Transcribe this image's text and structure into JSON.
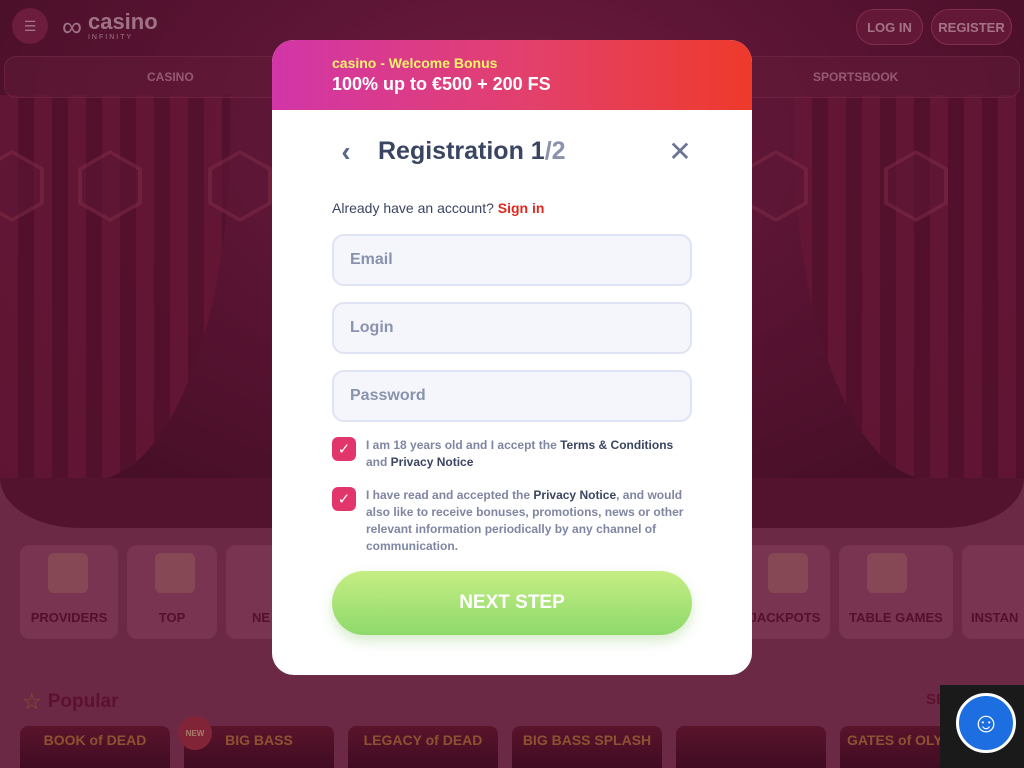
{
  "header": {
    "logo_text": "casino",
    "logo_subtext": "INFINITY",
    "login_label": "LOG IN",
    "register_label": "REGISTER"
  },
  "nav": {
    "items": [
      "CASINO",
      "SPORTSBOOK"
    ]
  },
  "categories": [
    "PROVIDERS",
    "TOP",
    "NE",
    "JACKPOTS",
    "TABLE GAMES",
    "INSTAN"
  ],
  "popular": {
    "heading": "Popular",
    "see_all": "SEE A",
    "games": [
      "BOOK of DEAD",
      "BIG BASS",
      "LEGACY of DEAD",
      "BIG BASS SPLASH",
      "",
      "GATES of OLYMPUS"
    ],
    "new_badge": "NEW"
  },
  "modal": {
    "bonus_sub": "casino - Welcome Bonus",
    "bonus_main": "100% up to €500 + 200 FS",
    "title_prefix": "Registration 1",
    "title_suffix": "/2",
    "account_prompt": "Already have an account?",
    "sign_in": "Sign in",
    "email_placeholder": "Email",
    "login_placeholder": "Login",
    "password_placeholder": "Password",
    "consent_1": {
      "text_a": "I am 18 years old and I accept the ",
      "link_a": "Terms & Conditions",
      "text_b": " and ",
      "link_b": "Privacy Notice"
    },
    "consent_2": {
      "text_a": "I have read and accepted the ",
      "link_a": "Privacy Notice",
      "text_b": ", and would also like to receive bonuses, promotions, news or other relevant information periodically by any channel of communication."
    },
    "next_label": "NEXT STEP"
  },
  "colors": {
    "banner_start": "#d236a8",
    "banner_end": "#ee3a2a",
    "checkbox": "#e2356b",
    "next_button": "#9fe06f",
    "sign_in_link": "#e0281f",
    "chat_button": "#1d6ee0"
  }
}
